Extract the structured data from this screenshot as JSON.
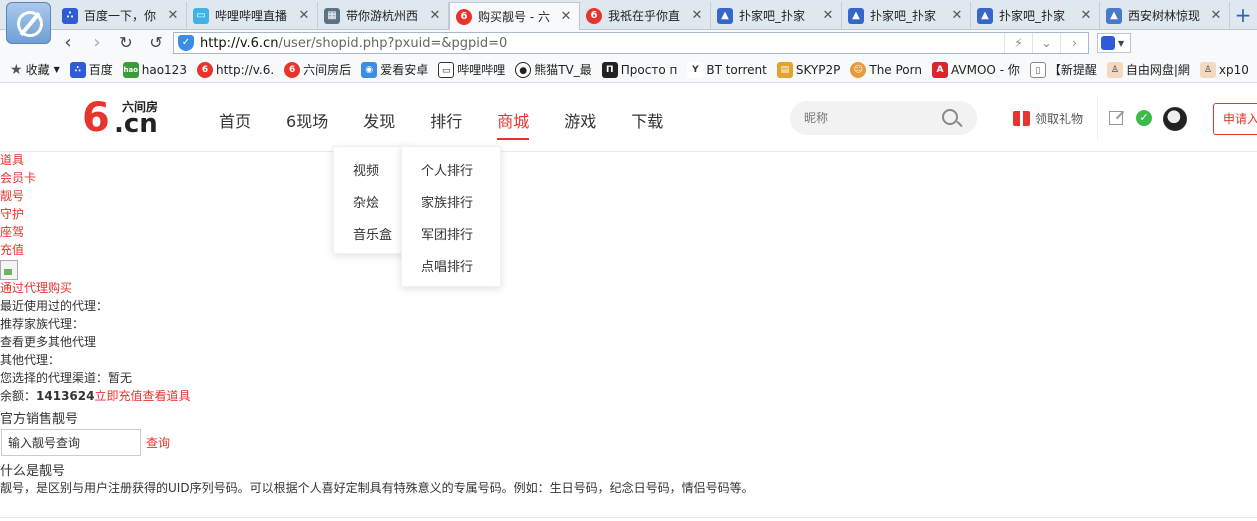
{
  "browser": {
    "tabs": [
      {
        "label": "百度一下，你",
        "icon": "baidu-paw-icon"
      },
      {
        "label": "哔哩哔哩直播",
        "icon": "bilibili-tv-icon"
      },
      {
        "label": "带你游杭州西",
        "icon": "document-icon"
      },
      {
        "label": "购买靓号 - 六",
        "icon": "six-logo-icon",
        "active": true
      },
      {
        "label": "我祇在乎你直",
        "icon": "six-logo-icon"
      },
      {
        "label": "扑家吧_扑家",
        "icon": "tieba-icon"
      },
      {
        "label": "扑家吧_扑家",
        "icon": "tieba-icon"
      },
      {
        "label": "扑家吧_扑家",
        "icon": "tieba-icon"
      },
      {
        "label": "西安树林惊现",
        "icon": "tieba-icon"
      }
    ],
    "url_host": "http://v.6.cn",
    "url_path": "/user/shopid.php?pxuid=&pgpid=0",
    "bookmarks": [
      {
        "label": "收藏",
        "icon": "star-icon"
      },
      {
        "label": "百度",
        "icon": "baidu-paw-icon"
      },
      {
        "label": "hao123",
        "icon": "hao123-icon"
      },
      {
        "label": "http://v.6.",
        "icon": "six-logo-icon"
      },
      {
        "label": "六间房后",
        "icon": "six-logo-icon"
      },
      {
        "label": "爱看安卓",
        "icon": "android-icon"
      },
      {
        "label": "哔哩哔哩",
        "icon": "bilibili-tv-icon"
      },
      {
        "label": "熊猫TV_最",
        "icon": "panda-icon"
      },
      {
        "label": "Просто п",
        "icon": "pinbox-icon"
      },
      {
        "label": "BT torrent",
        "icon": "torrent-icon"
      },
      {
        "label": "SKYP2P",
        "icon": "skyp2p-icon"
      },
      {
        "label": "The Porn",
        "icon": "avatar-icon"
      },
      {
        "label": "AVMOO - 你",
        "icon": "avmoo-icon"
      },
      {
        "label": "【新提醒",
        "icon": "document-icon"
      },
      {
        "label": "自由网盘|網",
        "icon": "person-icon"
      },
      {
        "label": "xp10",
        "icon": "person-icon"
      }
    ]
  },
  "site": {
    "logo_text": "6",
    "logo_cn": ".cn",
    "logo_sub": "六间房",
    "nav": [
      "首页",
      "6现场",
      "发现",
      "排行",
      "商城",
      "游戏",
      "下载"
    ],
    "nav_active": "商城",
    "search_placeholder": "昵称",
    "gift_label": "领取礼物",
    "apply_label": "申请入",
    "discover_menu": [
      "视频",
      "杂烩",
      "音乐盒"
    ],
    "rank_menu": [
      "个人排行",
      "家族排行",
      "军团排行",
      "点唱排行"
    ]
  },
  "content": {
    "category_links": [
      "道具",
      "会员卡",
      "靓号",
      "守护",
      "座驾",
      "充值"
    ],
    "agent_buy": "通过代理购买",
    "recent_agent": "最近使用过的代理：",
    "recommended_family_agent": "推荐家族代理：",
    "view_more_agents": "查看更多其他代理",
    "other_agents": "其他代理：",
    "selected_channel": "您选择的代理渠道：暂无",
    "balance_label": "余额：",
    "balance_value": "1413624",
    "recharge_link": "立即充值",
    "view_props_link": "查看道具",
    "official_title": "官方销售靓号",
    "query_input_value": "输入靓号查询",
    "query_button": "查询",
    "what_is_title": "什么是靓号",
    "what_is_desc": "靓号，是区别与用户注册获得的UID序列号码。可以根据个人喜好定制具有特殊意义的专属号码。例如：生日号码，纪念日号码，情侣号码等。"
  },
  "colors": {
    "accent": "#e8342c",
    "text": "#333333"
  }
}
